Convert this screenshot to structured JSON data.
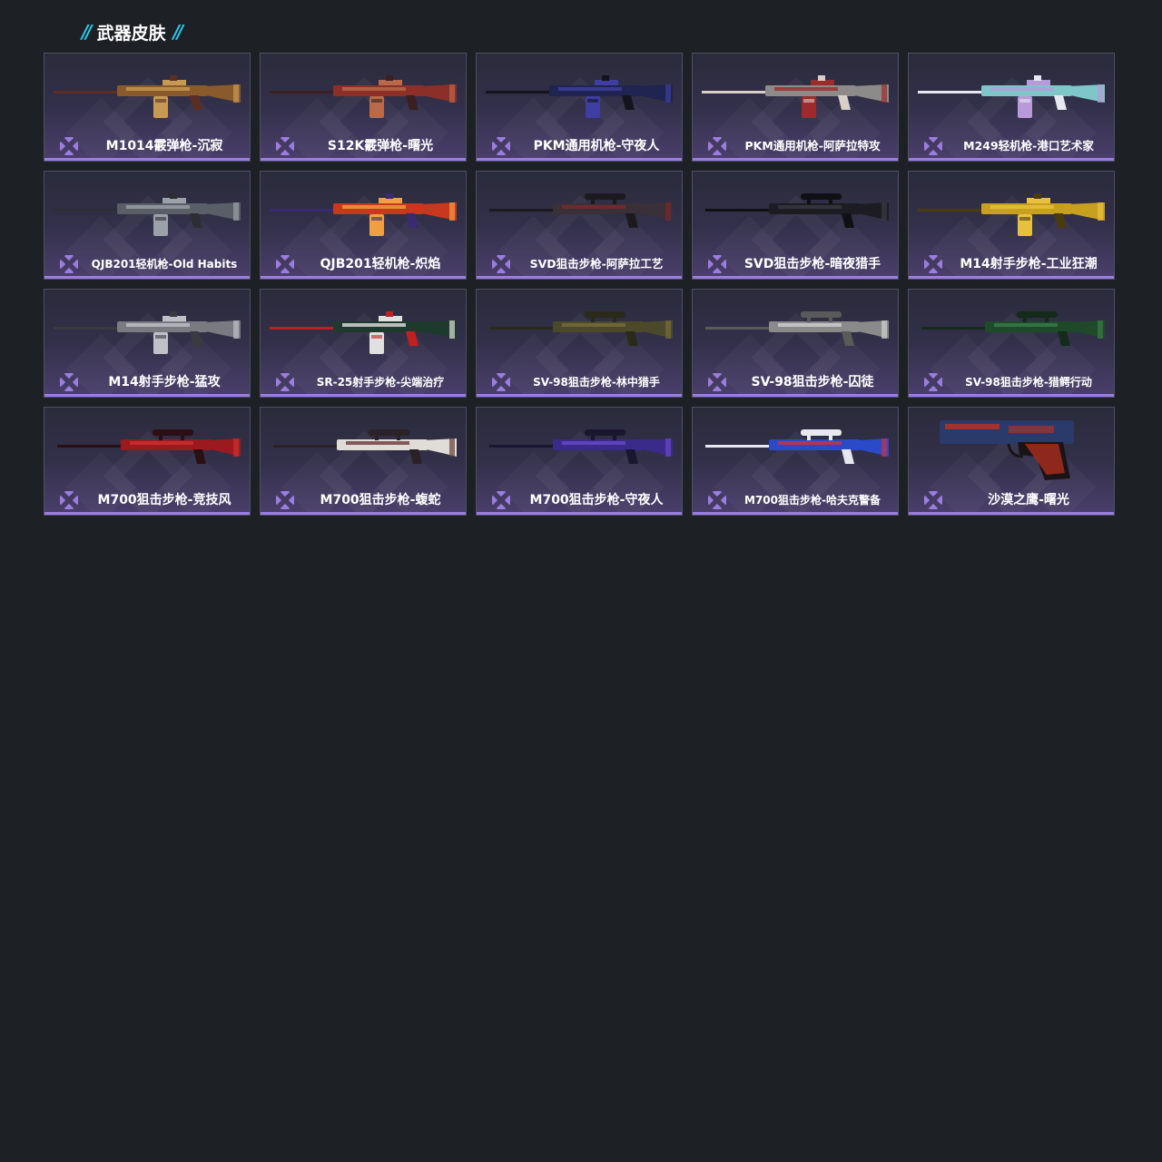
{
  "section": {
    "title": "武器皮肤",
    "accent_color": "#2bc6e6"
  },
  "rarity_color": "#9b7de0",
  "skins": [
    {
      "name": "M1014霰弹枪-沉寂",
      "icon": "shotgun-icon",
      "palette": [
        "#8a5a2c",
        "#c79a54",
        "#5a2e22"
      ]
    },
    {
      "name": "S12K霰弹枪-曙光",
      "icon": "shotgun-icon",
      "palette": [
        "#8c2f28",
        "#b86a4a",
        "#3a2020"
      ]
    },
    {
      "name": "PKM通用机枪-守夜人",
      "icon": "machine-gun-icon",
      "palette": [
        "#1f2450",
        "#3e3fa0",
        "#14141c"
      ]
    },
    {
      "name": "PKM通用机枪-阿萨拉特攻",
      "icon": "machine-gun-icon",
      "palette": [
        "#8d8a8a",
        "#9c2c2c",
        "#d8d0c8"
      ]
    },
    {
      "name": "M249轻机枪-港口艺术家",
      "icon": "machine-gun-icon",
      "palette": [
        "#7ec6c8",
        "#b89ad8",
        "#e8e8f0"
      ]
    },
    {
      "name": "QJB201轻机枪-Old Habits",
      "icon": "machine-gun-icon",
      "palette": [
        "#5a5e66",
        "#9ca0a8",
        "#2c2e34"
      ]
    },
    {
      "name": "QJB201轻机枪-炽焰",
      "icon": "machine-gun-icon",
      "palette": [
        "#c8381e",
        "#f0a040",
        "#3a2a70"
      ]
    },
    {
      "name": "SVD狙击步枪-阿萨拉工艺",
      "icon": "sniper-rifle-icon",
      "palette": [
        "#3a3038",
        "#7a2a2a",
        "#1c1a1e"
      ]
    },
    {
      "name": "SVD狙击步枪-暗夜猎手",
      "icon": "sniper-rifle-icon",
      "palette": [
        "#1c1c22",
        "#3a3a44",
        "#101014"
      ]
    },
    {
      "name": "M14射手步枪-工业狂潮",
      "icon": "rifle-icon",
      "palette": [
        "#c8a020",
        "#e8c040",
        "#4a3a10"
      ]
    },
    {
      "name": "M14射手步枪-猛攻",
      "icon": "rifle-icon",
      "palette": [
        "#7a7a82",
        "#c0c0c8",
        "#3a3a40"
      ]
    },
    {
      "name": "SR-25射手步枪-尖端治疗",
      "icon": "rifle-icon",
      "palette": [
        "#1e3a2c",
        "#e0e0e0",
        "#c02020"
      ]
    },
    {
      "name": "SV-98狙击步枪-林中猎手",
      "icon": "sniper-rifle-icon",
      "palette": [
        "#4a4a2a",
        "#7a6a3a",
        "#2a2a1a"
      ]
    },
    {
      "name": "SV-98狙击步枪-囚徒",
      "icon": "sniper-rifle-icon",
      "palette": [
        "#8a8a8a",
        "#d0d0d0",
        "#5a5a5a"
      ]
    },
    {
      "name": "SV-98狙击步枪-猎鳄行动",
      "icon": "sniper-rifle-icon",
      "palette": [
        "#1e4a2a",
        "#3a7a4a",
        "#142a1a"
      ]
    },
    {
      "name": "M700狙击步枪-竞技风",
      "icon": "sniper-rifle-icon",
      "palette": [
        "#9a1a20",
        "#d03030",
        "#2a1014"
      ]
    },
    {
      "name": "M700狙击步枪-蝮蛇",
      "icon": "sniper-rifle-icon",
      "palette": [
        "#e0dcd8",
        "#6a3a3a",
        "#2a2226"
      ]
    },
    {
      "name": "M700狙击步枪-守夜人",
      "icon": "sniper-rifle-icon",
      "palette": [
        "#3a2a8a",
        "#6a4ac8",
        "#1a1630"
      ]
    },
    {
      "name": "M700狙击步枪-哈夫克警备",
      "icon": "sniper-rifle-icon",
      "palette": [
        "#2a4ac8",
        "#d03040",
        "#e8e8f0"
      ]
    },
    {
      "name": "沙漠之鹰-曙光",
      "icon": "pistol-icon",
      "palette": [
        "#2a3a6a",
        "#c03020",
        "#1a1418"
      ]
    }
  ]
}
